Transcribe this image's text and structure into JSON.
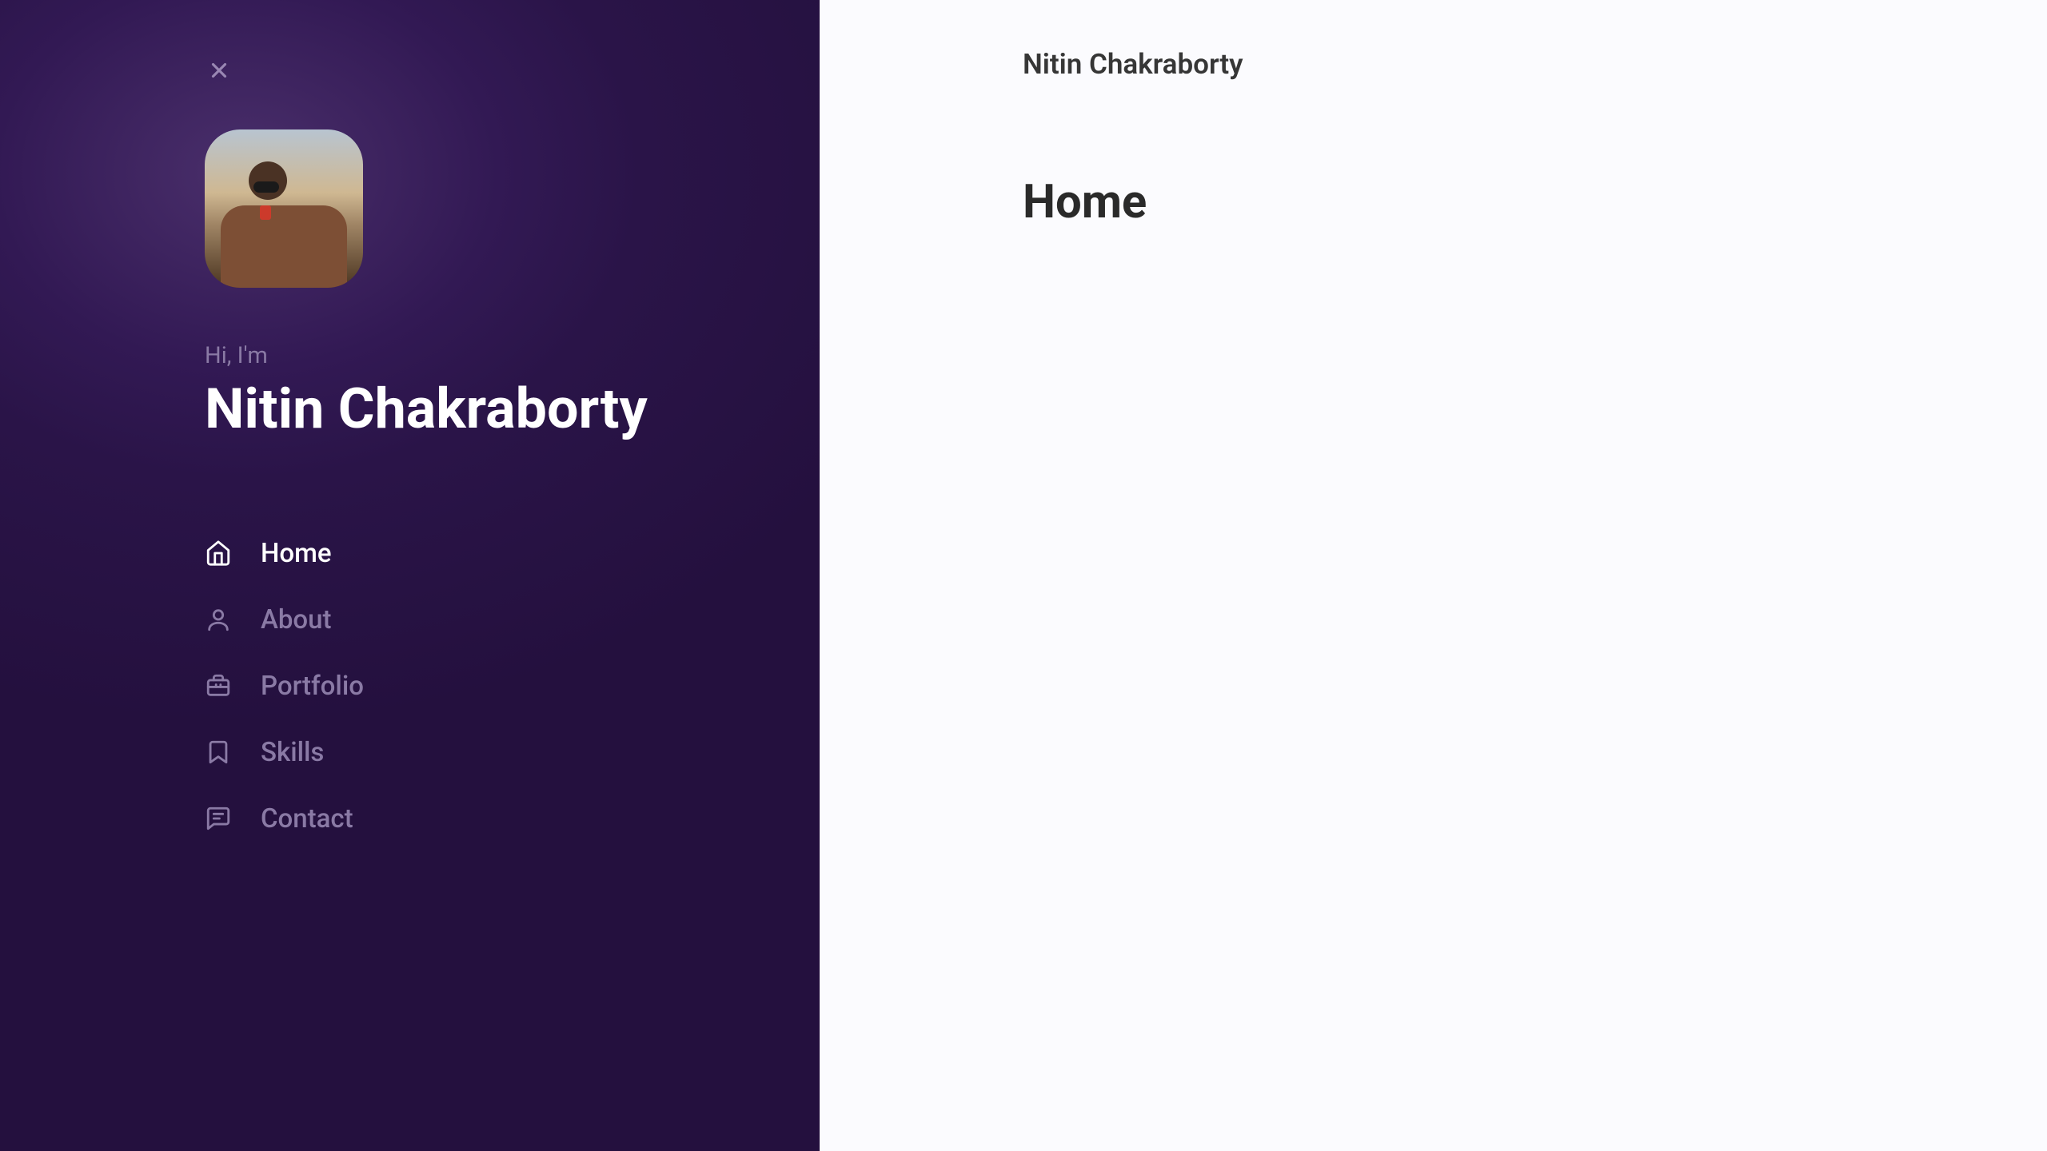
{
  "sidebar": {
    "greeting": "Hi, I'm",
    "name": "Nitin Chakraborty",
    "nav": [
      {
        "label": "Home",
        "icon": "home-icon",
        "active": true
      },
      {
        "label": "About",
        "icon": "user-icon",
        "active": false
      },
      {
        "label": "Portfolio",
        "icon": "briefcase-icon",
        "active": false
      },
      {
        "label": "Skills",
        "icon": "bookmark-icon",
        "active": false
      },
      {
        "label": "Contact",
        "icon": "message-icon",
        "active": false
      }
    ]
  },
  "main": {
    "name": "Nitin Chakraborty",
    "title": "Home"
  }
}
